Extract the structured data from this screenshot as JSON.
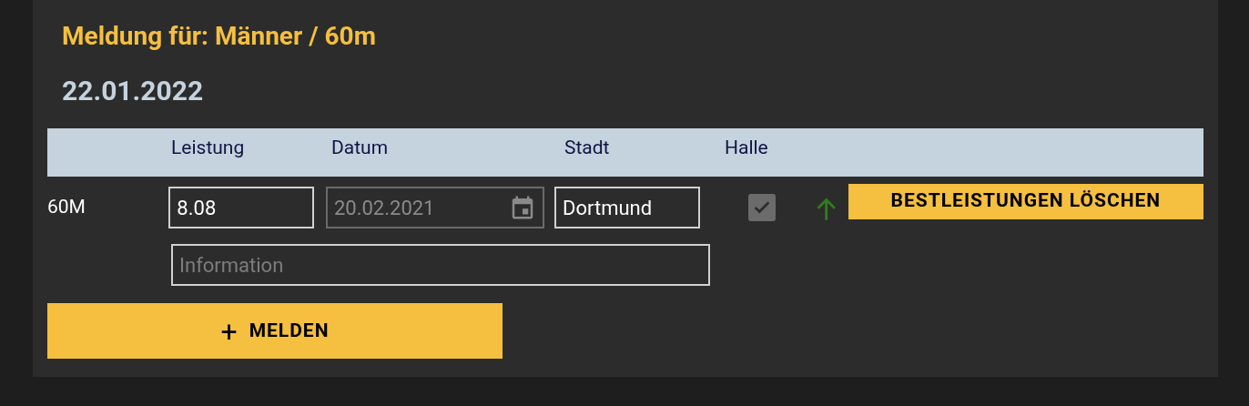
{
  "title": "Meldung für: Männer / 60m",
  "date": "22.01.2022",
  "table": {
    "columns": [
      "",
      "Leistung",
      "Datum",
      "Stadt",
      "Halle"
    ],
    "rows": [
      {
        "discipline": "60M",
        "performance": "8.08",
        "date": {
          "value": "20.02.2021",
          "disabled": true
        },
        "city": "Dortmund",
        "indoor": {
          "checked": true,
          "disabled": true
        },
        "delete_button": "BESTLEISTUNGEN LÖSCHEN",
        "info": {
          "placeholder": "Information"
        }
      }
    ]
  },
  "submit_button": {
    "icon": "+",
    "label": "MELDEN"
  }
}
